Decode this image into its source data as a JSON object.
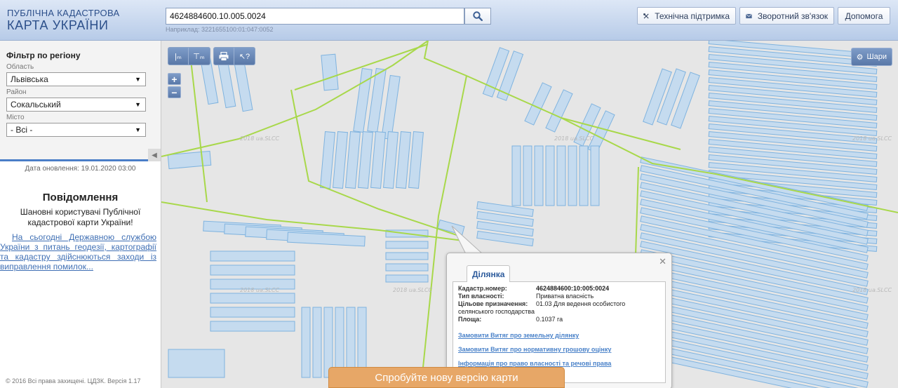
{
  "header": {
    "logo_line1": "Публічна кадастрова",
    "logo_line2": "Карта України",
    "search_value": "4624884600.10.005.0024",
    "search_hint": "Наприклад: 3221655100:01:047:0052",
    "buttons": [
      {
        "label": "Технічна підтримка",
        "icon": "tools-icon"
      },
      {
        "label": "Зворотний зв'язок",
        "icon": "envelope-icon"
      },
      {
        "label": "Допомога",
        "icon": ""
      }
    ]
  },
  "sidebar": {
    "filter_title": "Фільтр по регіону",
    "region_label": "Область",
    "region_value": "Львівська",
    "district_label": "Район",
    "district_value": "Сокальський",
    "city_label": "Місто",
    "city_value": "- Всі -",
    "update_date": "Дата оновлення: 19.01.2020 03:00",
    "notice_title": "Повідомлення",
    "notice_text": "Шановні користувачі Публічної кадастрової карти України!",
    "notice_link": "На сьогодні Державною службою України з питань геодезії, картографії та кадастру здійснюються заходи із виправлення помилок...",
    "copyright": "© 2016 Всі права захищені. ЦДЗК. Версія 1.17"
  },
  "map": {
    "layers_label": "Шари",
    "watermark": "2018 ua.SLCC",
    "colors": {
      "parcel_fill": "#c5dbef",
      "parcel_stroke": "#7fb3df",
      "boundary": "#a8d84a"
    }
  },
  "popup": {
    "tab_label": "Ділянка",
    "rows": [
      {
        "key": "Кадастр.номер:",
        "value": "4624884600:10:005:0024",
        "bold": true
      },
      {
        "key": "Тип власності:",
        "value": "Приватна власність"
      },
      {
        "key": "Цільове призначення:",
        "value": "01.03 Для ведення особистого"
      }
    ],
    "purpose_cont": "селянського господарства",
    "area_key": "Площа:",
    "area_value": "0.1037 га",
    "links": [
      "Замовити Витяг про земельну ділянку",
      "Замовити Витяг про нормативну грошову оцінку",
      "Інформація про право власності та речові права"
    ]
  },
  "banner": "Спробуйте нову версію карти"
}
